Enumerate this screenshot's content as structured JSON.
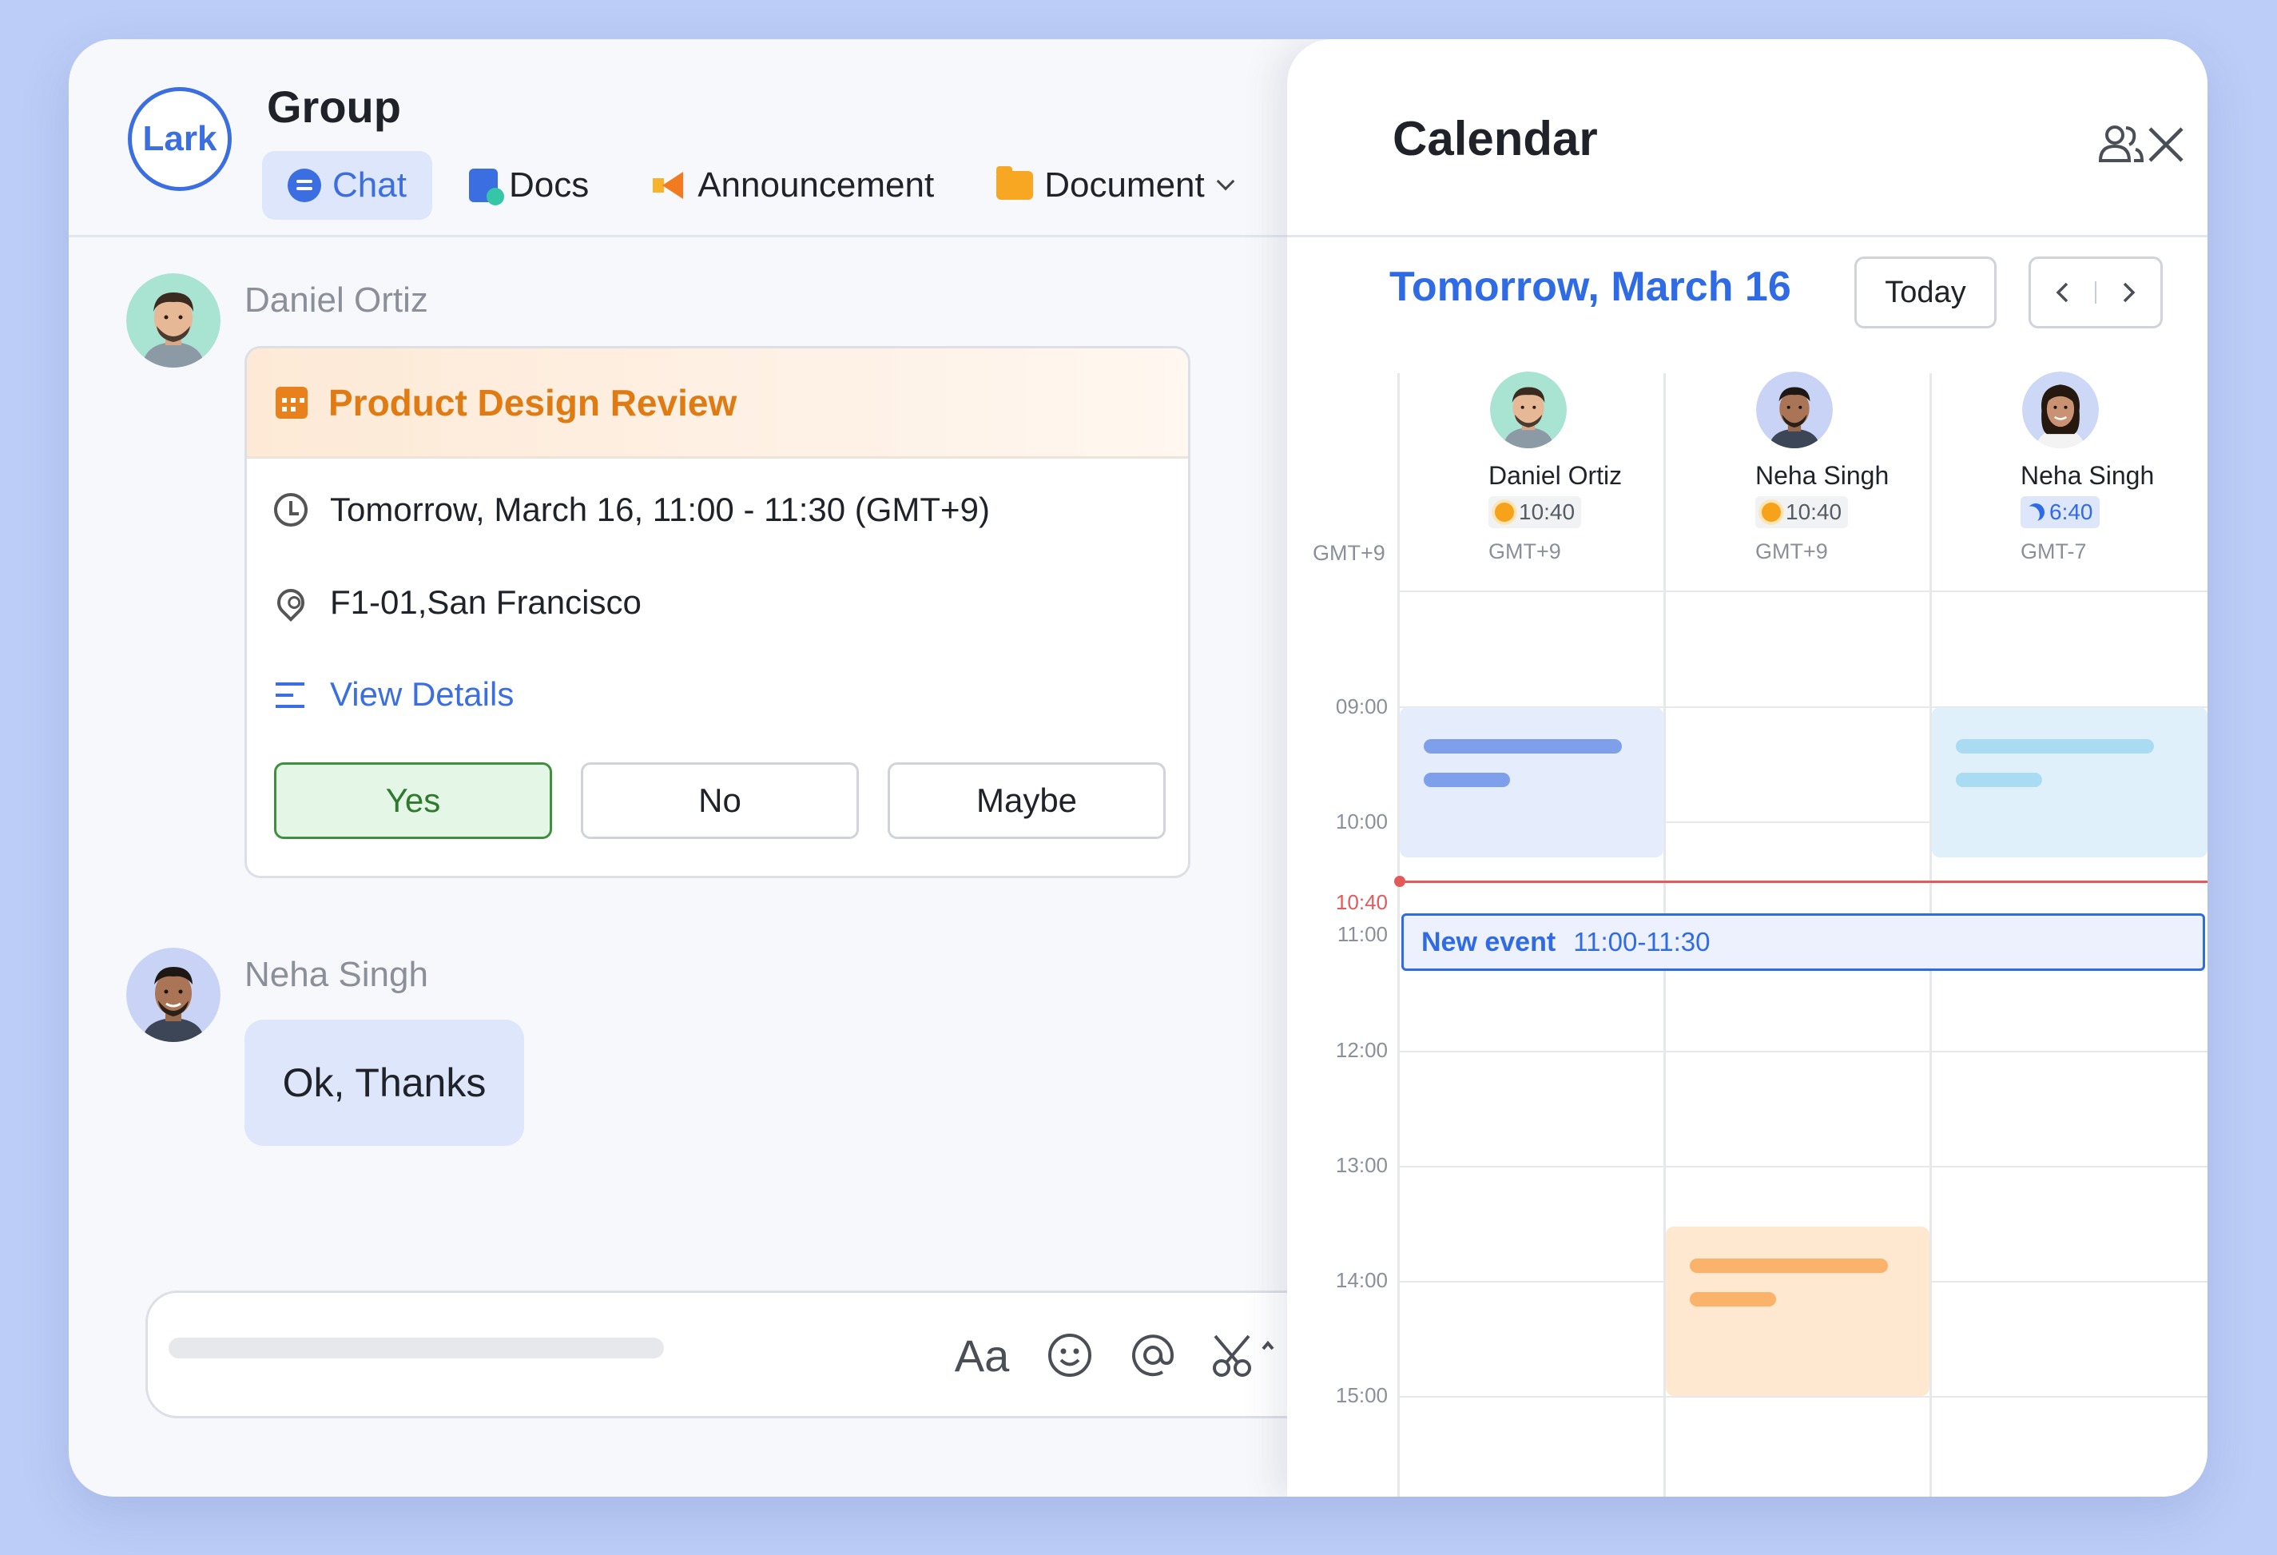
{
  "chat": {
    "logo": "Lark",
    "group_title": "Group",
    "tabs": [
      {
        "label": "Chat",
        "icon": "chat-bubble-icon",
        "active": true
      },
      {
        "label": "Docs",
        "icon": "docs-icon",
        "active": false
      },
      {
        "label": "Announcement",
        "icon": "megaphone-icon",
        "active": false
      },
      {
        "label": "Document",
        "icon": "folder-icon",
        "active": false
      }
    ],
    "messages": [
      {
        "sender": "Daniel Ortiz",
        "card": {
          "title": "Product Design Review",
          "datetime": "Tomorrow, March 16, 11:00 - 11:30 (GMT+9)",
          "location": "F1-01,San Francisco",
          "details_link": "View Details",
          "rsvp": {
            "yes": "Yes",
            "no": "No",
            "maybe": "Maybe"
          },
          "selected_rsvp": "Yes"
        }
      },
      {
        "sender": "Neha Singh",
        "text": "Ok, Thanks"
      }
    ],
    "composer": {
      "tools": [
        "text-format-icon",
        "emoji-icon",
        "mention-icon",
        "scissors-icon",
        "add-icon"
      ],
      "format_glyph": "Aa"
    }
  },
  "calendar": {
    "title": "Calendar",
    "date_title": "Tomorrow, March 16",
    "today_label": "Today",
    "base_timezone": "GMT+9",
    "people": [
      {
        "name": "Daniel Ortiz",
        "local_time": "10:40",
        "daytime": true,
        "timezone": "GMT+9"
      },
      {
        "name": "Neha Singh",
        "local_time": "10:40",
        "daytime": true,
        "timezone": "GMT+9"
      },
      {
        "name": "Neha Singh",
        "local_time": "6:40",
        "daytime": false,
        "timezone": "GMT-7"
      }
    ],
    "hours": [
      "09:00",
      "10:00",
      "11:00",
      "12:00",
      "13:00",
      "14:00",
      "15:00"
    ],
    "current_time": "10:40",
    "new_event": {
      "title": "New event",
      "time": "11:00-11:30"
    },
    "colors": {
      "accent": "#2f6be5",
      "now_line": "#e25a5a",
      "busy_blue": "#e5ecfc",
      "busy_cyan": "#dff0fa",
      "busy_orange": "#ffe8cf",
      "rsvp_yes": "#e4f6e6"
    }
  }
}
